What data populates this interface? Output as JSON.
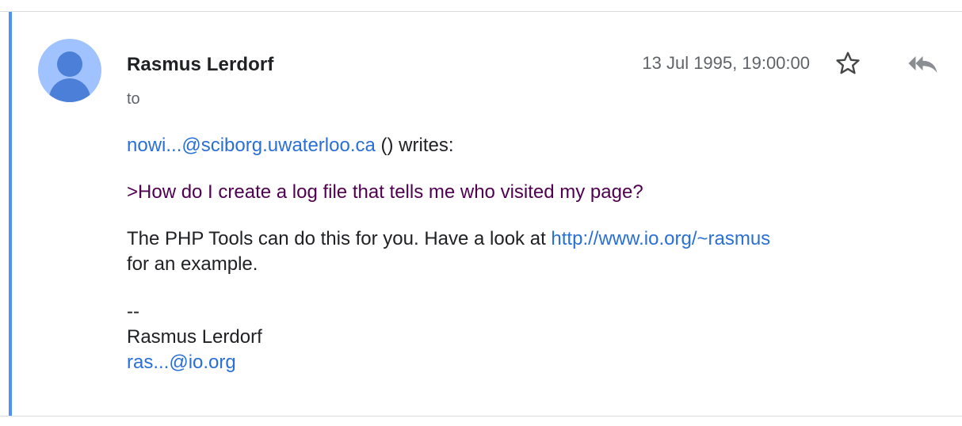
{
  "message": {
    "sender": "Rasmus Lerdorf",
    "to_label": "to",
    "timestamp": "13 Jul 1995, 19:00:00",
    "writes_email": "nowi...@sciborg.uwaterloo.ca",
    "writes_suffix": " () writes:",
    "quoted_line": ">How do I create a log file that tells me who visited my page?",
    "reply_text_before": "The PHP Tools can do this for you. Have a look at ",
    "reply_link": "http://www.io.org/~rasmus",
    "reply_text_after": "for an example.",
    "sig_dash": "--",
    "sig_name": "Rasmus Lerdorf",
    "sig_email": "ras...@io.org"
  },
  "icons": {
    "avatar": "person-avatar-icon",
    "star": "star-outline-icon",
    "reply_all": "reply-all-icon"
  },
  "colors": {
    "accent": "#4d90fe",
    "link": "#2a6fd6",
    "quote": "#500050",
    "avatar_bg": "#a0c3ff",
    "avatar_fg": "#4c7fd8"
  }
}
